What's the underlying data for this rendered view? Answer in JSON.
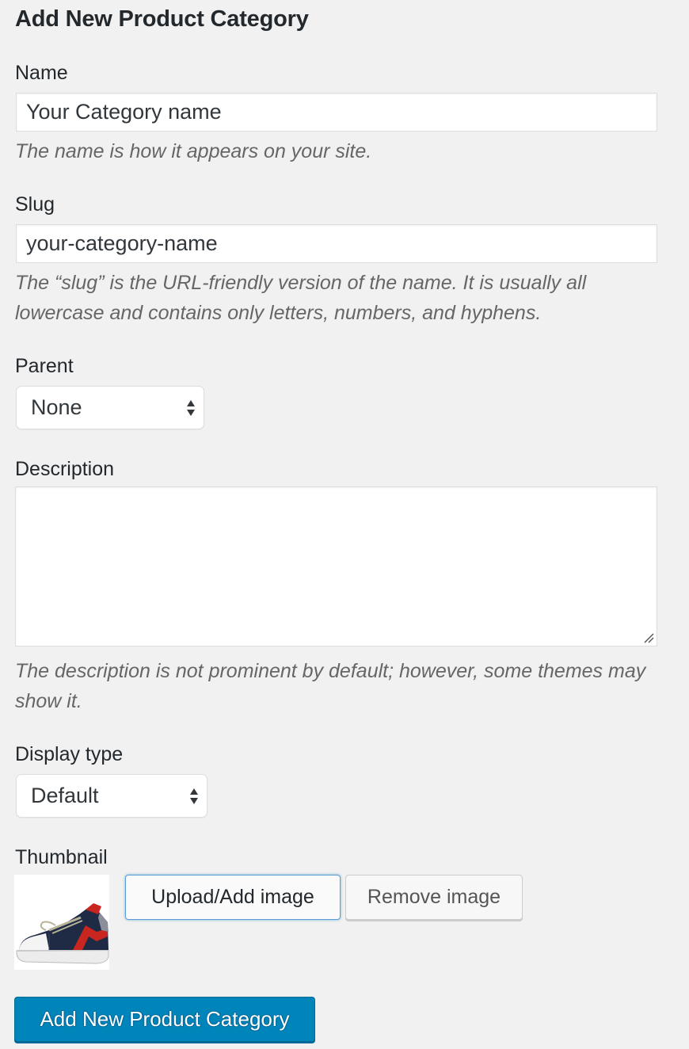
{
  "form": {
    "title": "Add New Product Category",
    "name": {
      "label": "Name",
      "value": "Your Category name",
      "help": "The name is how it appears on your site."
    },
    "slug": {
      "label": "Slug",
      "value": "your-category-name",
      "help": "The “slug” is the URL-friendly version of the name. It is usually all lowercase and contains only letters, numbers, and hyphens."
    },
    "parent": {
      "label": "Parent",
      "selected": "None"
    },
    "description": {
      "label": "Description",
      "value": "",
      "help": "The description is not prominent by default; however, some themes may show it."
    },
    "display_type": {
      "label": "Display type",
      "selected": "Default"
    },
    "thumbnail": {
      "label": "Thumbnail",
      "image": "sneaker-thumbnail",
      "upload_label": "Upload/Add image",
      "remove_label": "Remove image"
    },
    "submit_label": "Add New Product Category"
  },
  "colors": {
    "background": "#f1f1f1",
    "primary_button": "#0085ba",
    "focus_border": "#5b9dd9",
    "help_text": "#666666"
  }
}
